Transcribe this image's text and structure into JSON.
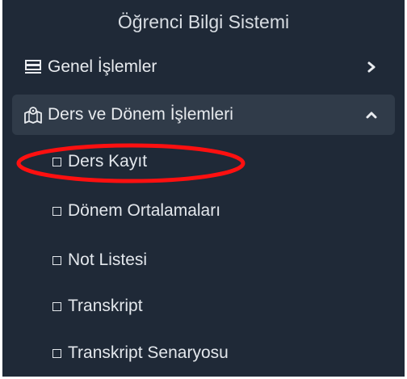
{
  "sidebar": {
    "title": "Öğrenci Bilgi Sistemi",
    "background_color": "#1f2937",
    "active_item_color": "#303b49",
    "items": [
      {
        "label": "Genel İşlemler",
        "icon": "server-icon",
        "expanded": false
      },
      {
        "label": "Ders ve Dönem İşlemleri",
        "icon": "map-icon",
        "expanded": true
      }
    ],
    "sub_items": [
      {
        "label": "Ders Kayıt",
        "highlighted": true
      },
      {
        "label": "Dönem Ortalamaları"
      },
      {
        "label": "Not Listesi"
      },
      {
        "label": "Transkript"
      },
      {
        "label": "Transkript Senaryosu"
      }
    ]
  },
  "annotation": {
    "color": "#ff1010",
    "target": "Ders Kayıt"
  }
}
